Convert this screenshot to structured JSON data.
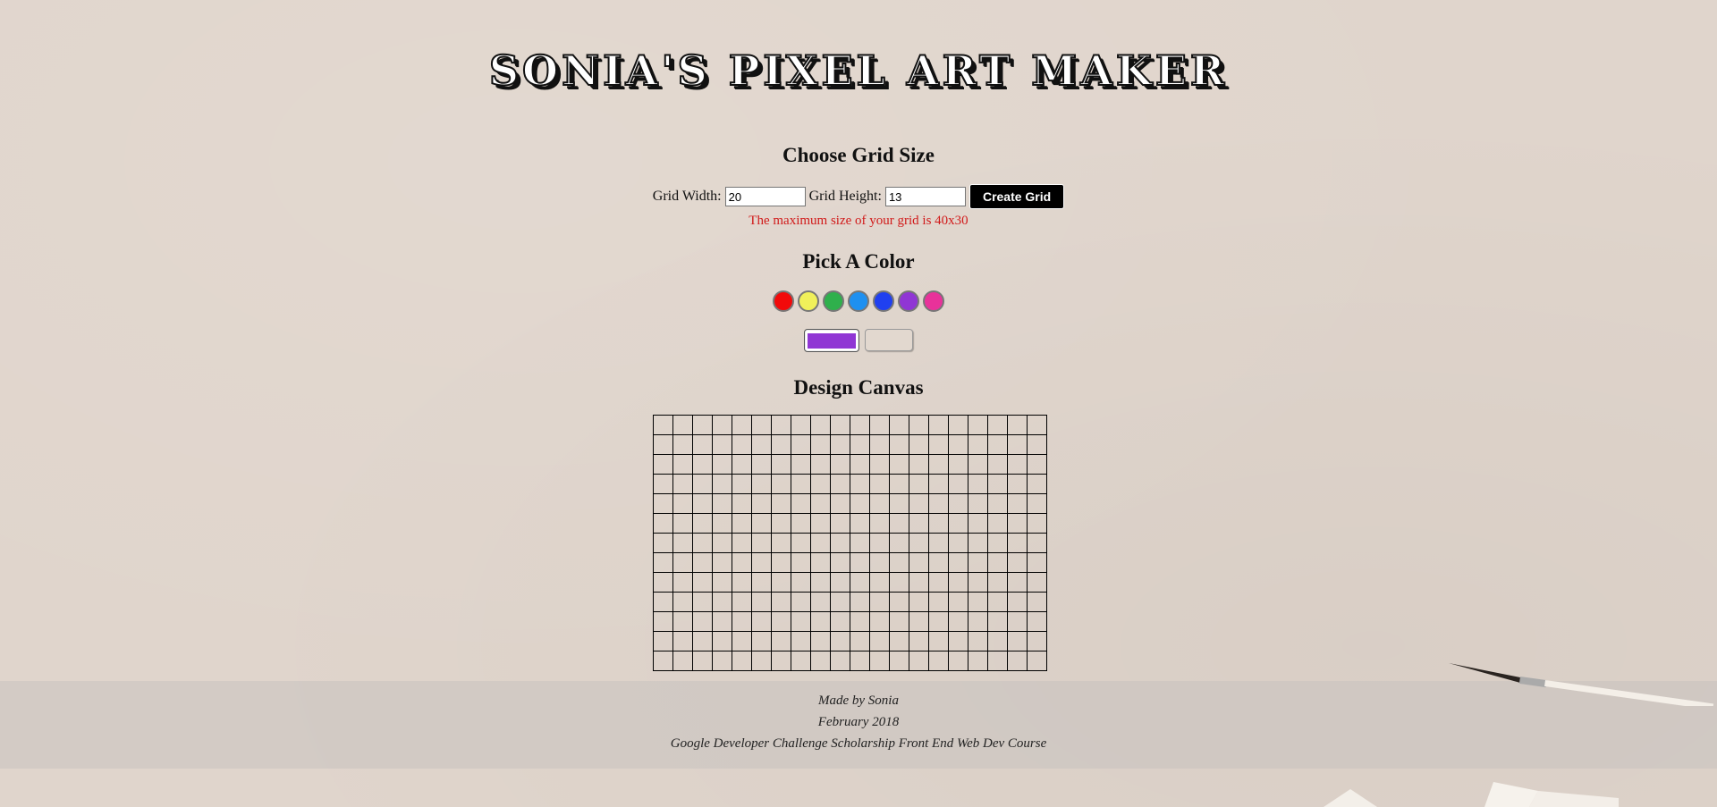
{
  "header": {
    "title": "SONIA'S PIXEL ART MAKER"
  },
  "grid_size": {
    "heading": "Choose Grid Size",
    "width_label": "Grid Width:",
    "width_value": "20",
    "height_label": "Grid Height:",
    "height_value": "13",
    "create_button": "Create Grid",
    "max_note": "The maximum size of your grid is 40x30"
  },
  "color": {
    "heading": "Pick A Color",
    "swatches": [
      {
        "name": "red",
        "color": "#f20a0a"
      },
      {
        "name": "yellow",
        "color": "#f0f05a"
      },
      {
        "name": "green",
        "color": "#2fb04c"
      },
      {
        "name": "light-blue",
        "color": "#1e90f0"
      },
      {
        "name": "blue",
        "color": "#2040f0"
      },
      {
        "name": "purple",
        "color": "#9036d4"
      },
      {
        "name": "pink",
        "color": "#e8329a"
      }
    ],
    "current_color": "#9036d4"
  },
  "canvas": {
    "heading": "Design Canvas",
    "columns": 20,
    "rows": 13
  },
  "footer": {
    "line1": "Made by Sonia",
    "line2": "February 2018",
    "line3": "Google Developer Challenge Scholarship Front End Web Dev Course"
  },
  "colors": {
    "background": "#e0d5cc",
    "note_red": "#d11a1a",
    "button_bg": "#000000"
  }
}
